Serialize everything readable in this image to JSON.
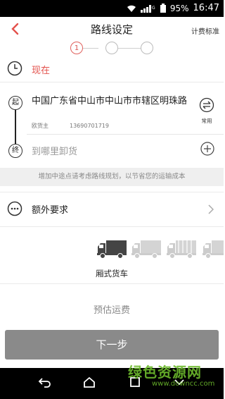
{
  "status_bar": {
    "battery": "95%",
    "time": "16:47"
  },
  "header": {
    "title": "路线设定",
    "fee_link": "计费标准"
  },
  "steps": [
    {
      "label": "1"
    },
    {
      "label": ""
    },
    {
      "label": ""
    }
  ],
  "time_row": {
    "text": "现在"
  },
  "route": {
    "start_badge": "起",
    "end_badge": "终",
    "start_address": "中国广东省中山市中山市市辖区明珠路",
    "contact_name": "欧货主",
    "contact_phone": "13690701719",
    "swap_label": "常用",
    "destination_placeholder": "到哪里卸货"
  },
  "hint": "增加中途点请考虑路线规划，以节省您的运输成本",
  "extra": {
    "label": "额外要求"
  },
  "vehicle": {
    "selected_label": "厢式货车"
  },
  "estimate": {
    "label": "预估运费"
  },
  "next_button": {
    "label": "下一步"
  },
  "watermark": {
    "line1": "绿色资源网",
    "line2": "www.downcc.com"
  },
  "colors": {
    "accent": "#e3514c",
    "button": "#8a8a8a",
    "hint_bg": "#efefef"
  },
  "icons": [
    "wifi-icon",
    "signal-icon",
    "battery-icon",
    "back-icon",
    "clock-icon",
    "swap-icon",
    "plus-circle-icon",
    "more-dots-icon",
    "chevron-right-icon",
    "truck-icon",
    "nav-back-icon",
    "nav-home-icon",
    "nav-recent-icon"
  ]
}
